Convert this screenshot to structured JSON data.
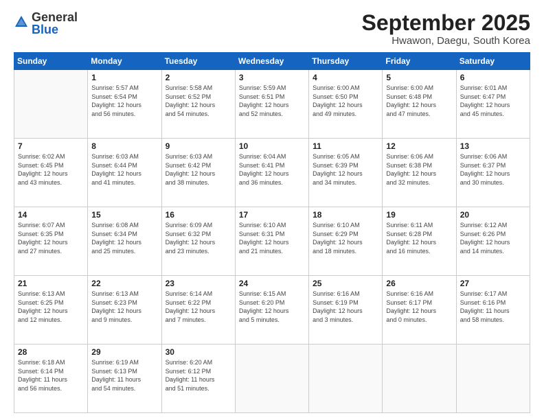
{
  "logo": {
    "general": "General",
    "blue": "Blue"
  },
  "header": {
    "month": "September 2025",
    "location": "Hwawon, Daegu, South Korea"
  },
  "weekdays": [
    "Sunday",
    "Monday",
    "Tuesday",
    "Wednesday",
    "Thursday",
    "Friday",
    "Saturday"
  ],
  "weeks": [
    [
      {
        "day": "",
        "info": ""
      },
      {
        "day": "1",
        "info": "Sunrise: 5:57 AM\nSunset: 6:54 PM\nDaylight: 12 hours\nand 56 minutes."
      },
      {
        "day": "2",
        "info": "Sunrise: 5:58 AM\nSunset: 6:52 PM\nDaylight: 12 hours\nand 54 minutes."
      },
      {
        "day": "3",
        "info": "Sunrise: 5:59 AM\nSunset: 6:51 PM\nDaylight: 12 hours\nand 52 minutes."
      },
      {
        "day": "4",
        "info": "Sunrise: 6:00 AM\nSunset: 6:50 PM\nDaylight: 12 hours\nand 49 minutes."
      },
      {
        "day": "5",
        "info": "Sunrise: 6:00 AM\nSunset: 6:48 PM\nDaylight: 12 hours\nand 47 minutes."
      },
      {
        "day": "6",
        "info": "Sunrise: 6:01 AM\nSunset: 6:47 PM\nDaylight: 12 hours\nand 45 minutes."
      }
    ],
    [
      {
        "day": "7",
        "info": "Sunrise: 6:02 AM\nSunset: 6:45 PM\nDaylight: 12 hours\nand 43 minutes."
      },
      {
        "day": "8",
        "info": "Sunrise: 6:03 AM\nSunset: 6:44 PM\nDaylight: 12 hours\nand 41 minutes."
      },
      {
        "day": "9",
        "info": "Sunrise: 6:03 AM\nSunset: 6:42 PM\nDaylight: 12 hours\nand 38 minutes."
      },
      {
        "day": "10",
        "info": "Sunrise: 6:04 AM\nSunset: 6:41 PM\nDaylight: 12 hours\nand 36 minutes."
      },
      {
        "day": "11",
        "info": "Sunrise: 6:05 AM\nSunset: 6:39 PM\nDaylight: 12 hours\nand 34 minutes."
      },
      {
        "day": "12",
        "info": "Sunrise: 6:06 AM\nSunset: 6:38 PM\nDaylight: 12 hours\nand 32 minutes."
      },
      {
        "day": "13",
        "info": "Sunrise: 6:06 AM\nSunset: 6:37 PM\nDaylight: 12 hours\nand 30 minutes."
      }
    ],
    [
      {
        "day": "14",
        "info": "Sunrise: 6:07 AM\nSunset: 6:35 PM\nDaylight: 12 hours\nand 27 minutes."
      },
      {
        "day": "15",
        "info": "Sunrise: 6:08 AM\nSunset: 6:34 PM\nDaylight: 12 hours\nand 25 minutes."
      },
      {
        "day": "16",
        "info": "Sunrise: 6:09 AM\nSunset: 6:32 PM\nDaylight: 12 hours\nand 23 minutes."
      },
      {
        "day": "17",
        "info": "Sunrise: 6:10 AM\nSunset: 6:31 PM\nDaylight: 12 hours\nand 21 minutes."
      },
      {
        "day": "18",
        "info": "Sunrise: 6:10 AM\nSunset: 6:29 PM\nDaylight: 12 hours\nand 18 minutes."
      },
      {
        "day": "19",
        "info": "Sunrise: 6:11 AM\nSunset: 6:28 PM\nDaylight: 12 hours\nand 16 minutes."
      },
      {
        "day": "20",
        "info": "Sunrise: 6:12 AM\nSunset: 6:26 PM\nDaylight: 12 hours\nand 14 minutes."
      }
    ],
    [
      {
        "day": "21",
        "info": "Sunrise: 6:13 AM\nSunset: 6:25 PM\nDaylight: 12 hours\nand 12 minutes."
      },
      {
        "day": "22",
        "info": "Sunrise: 6:13 AM\nSunset: 6:23 PM\nDaylight: 12 hours\nand 9 minutes."
      },
      {
        "day": "23",
        "info": "Sunrise: 6:14 AM\nSunset: 6:22 PM\nDaylight: 12 hours\nand 7 minutes."
      },
      {
        "day": "24",
        "info": "Sunrise: 6:15 AM\nSunset: 6:20 PM\nDaylight: 12 hours\nand 5 minutes."
      },
      {
        "day": "25",
        "info": "Sunrise: 6:16 AM\nSunset: 6:19 PM\nDaylight: 12 hours\nand 3 minutes."
      },
      {
        "day": "26",
        "info": "Sunrise: 6:16 AM\nSunset: 6:17 PM\nDaylight: 12 hours\nand 0 minutes."
      },
      {
        "day": "27",
        "info": "Sunrise: 6:17 AM\nSunset: 6:16 PM\nDaylight: 11 hours\nand 58 minutes."
      }
    ],
    [
      {
        "day": "28",
        "info": "Sunrise: 6:18 AM\nSunset: 6:14 PM\nDaylight: 11 hours\nand 56 minutes."
      },
      {
        "day": "29",
        "info": "Sunrise: 6:19 AM\nSunset: 6:13 PM\nDaylight: 11 hours\nand 54 minutes."
      },
      {
        "day": "30",
        "info": "Sunrise: 6:20 AM\nSunset: 6:12 PM\nDaylight: 11 hours\nand 51 minutes."
      },
      {
        "day": "",
        "info": ""
      },
      {
        "day": "",
        "info": ""
      },
      {
        "day": "",
        "info": ""
      },
      {
        "day": "",
        "info": ""
      }
    ]
  ]
}
